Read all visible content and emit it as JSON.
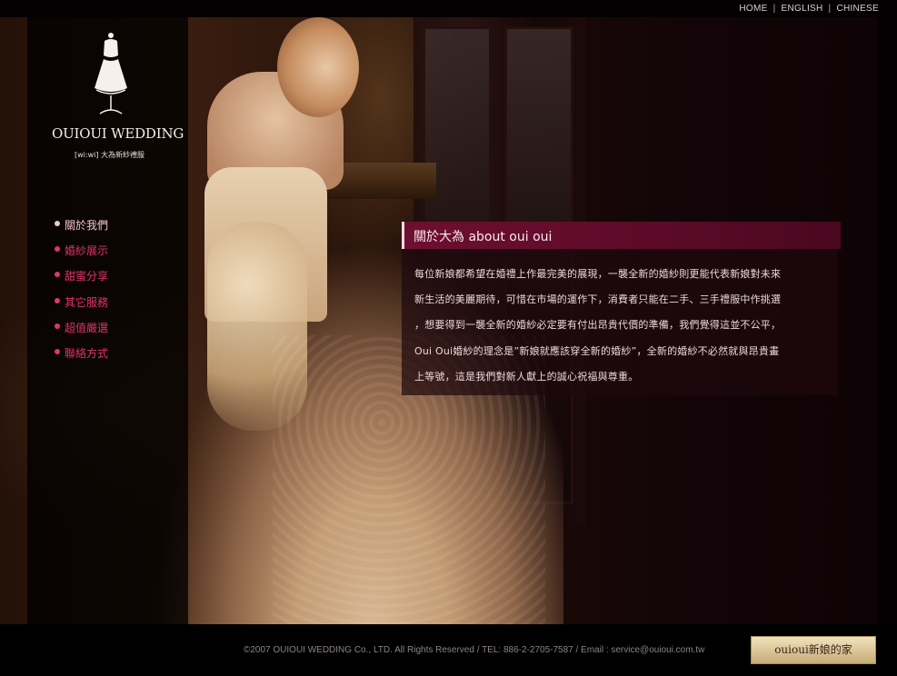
{
  "topnav": {
    "home": "HOME",
    "english": "ENGLISH",
    "chinese": "CHINESE",
    "separator": "|"
  },
  "logo": {
    "brand": "OUIOUI WEDDING",
    "sub": "[wi:wi]    大為新紗禮服",
    "icon": "dress-form-icon"
  },
  "menu": {
    "items": [
      {
        "label": "關於我們",
        "active": true
      },
      {
        "label": "婚紗展示"
      },
      {
        "label": "甜蜜分享"
      },
      {
        "label": "其它服務"
      },
      {
        "label": "超值嚴選"
      },
      {
        "label": "聯絡方式"
      }
    ]
  },
  "content": {
    "title": "關於大為 about oui oui",
    "lines": [
      "每位新娘都希望在婚禮上作最完美的展現，一襲全新的婚紗則更能代表新娘對未來",
      "新生活的美麗期待，可惜在市場的運作下，消費者只能在二手、三手禮服中作挑選",
      "，想要得到一襲全新的婚紗必定要有付出昂貴代價的準備，我們覺得這並不公平，",
      "Oui Oui婚紗的理念是”新娘就應該穿全新的婚紗”，全新的婚紗不必然就與昂貴畫",
      "上等號，這是我們對新人獻上的誠心祝福與尊重。"
    ]
  },
  "footer": {
    "copyright": "©2007 OUIOUI WEDDING Co., LTD. All Rights Reserved / TEL: 886-2-2705-7587 / Email : service@ouioui.com.tw",
    "button_label": "ouioui新娘的家"
  },
  "colors": {
    "accent": "#e3336c",
    "header_bar": "#6e0f30",
    "background": "#0c0306"
  }
}
